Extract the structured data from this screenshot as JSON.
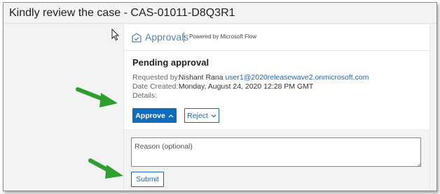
{
  "window": {
    "title": "Kindly review the case - CAS-01011-D8Q3R1"
  },
  "header": {
    "app_name": "Approvals",
    "powered_by": "Powered by Microsoft Flow"
  },
  "approval": {
    "status_title": "Pending approval",
    "requested_by_label": "Requested by:",
    "requested_by_name": "Nishant Rana",
    "requested_by_email": "user1@2020releasewave2.onmicrosoft.com",
    "date_created_label": "Date Created:",
    "date_created_value": "Monday, August 24, 2020 12:28 PM GMT",
    "details_label": "Details:"
  },
  "actions": {
    "approve_label": "Approve",
    "reject_label": "Reject"
  },
  "comment": {
    "placeholder": "Reason (optional)",
    "value": ""
  },
  "submit": {
    "label": "Submit"
  },
  "colors": {
    "accent": "#0f6cbd",
    "link": "#1a63b4",
    "annotation_arrow": "#2e9e2e"
  },
  "icons": [
    "cursor-icon",
    "approvals-icon",
    "chevron-up-icon",
    "chevron-down-icon",
    "resize-grip-icon",
    "annotation-arrow-icon"
  ]
}
